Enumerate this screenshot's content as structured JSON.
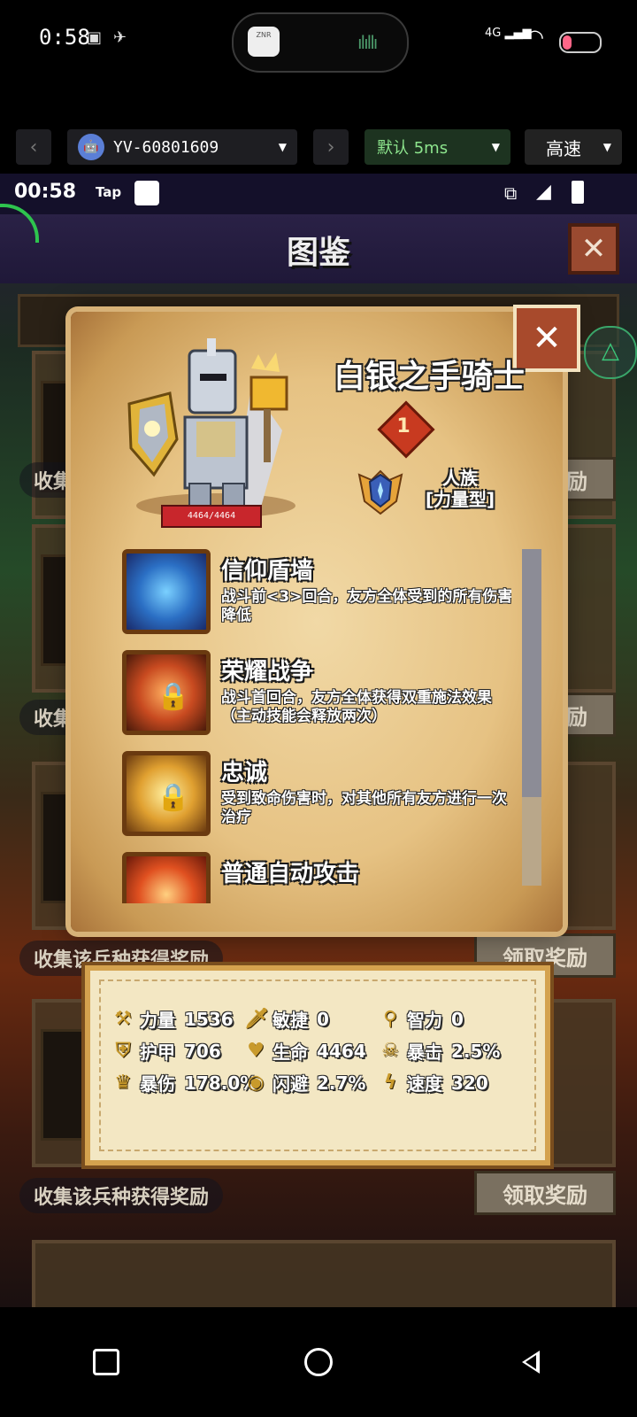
{
  "phone_status": {
    "time": "0:58",
    "signal": "4G",
    "island_app": "ZNR"
  },
  "toolbar": {
    "device": "YV-60801609",
    "mode": "默认 5ms",
    "speed": "高速"
  },
  "game_status": {
    "time": "00:58",
    "tap": "Tap"
  },
  "page": {
    "title": "图鉴"
  },
  "background": {
    "collect_label": "收集该兵种获得奖励",
    "claim_label": "领取奖励"
  },
  "unit": {
    "name": "白银之手骑士",
    "level": "1",
    "race": "人族",
    "type": "[力量型]",
    "hp": "4464/4464"
  },
  "skills": [
    {
      "name": "信仰盾墙",
      "desc": "战斗前<3>回合，友方全体受到的所有伤害降低",
      "locked": false
    },
    {
      "name": "荣耀战争",
      "desc": "战斗首回合，友方全体获得双重施法效果（主动技能会释放两次）",
      "locked": true
    },
    {
      "name": "忠诚",
      "desc": "受到致命伤害时，对其他所有友方进行一次治疗",
      "locked": true
    },
    {
      "name": "普通自动攻击",
      "desc": "",
      "locked": false
    }
  ],
  "stats": [
    {
      "icon": "axe-icon",
      "label": "力量",
      "value": "1536"
    },
    {
      "icon": "sword-icon",
      "label": "敏捷",
      "value": "0"
    },
    {
      "icon": "staff-icon",
      "label": "智力",
      "value": "0"
    },
    {
      "icon": "shield-icon",
      "label": "护甲",
      "value": "706"
    },
    {
      "icon": "heart-icon",
      "label": "生命",
      "value": "4464"
    },
    {
      "icon": "skull-icon",
      "label": "暴击",
      "value": "2.5%"
    },
    {
      "icon": "crown-icon",
      "label": "暴伤",
      "value": "178.0%"
    },
    {
      "icon": "eye-icon",
      "label": "闪避",
      "value": "2.7%"
    },
    {
      "icon": "lightning-icon",
      "label": "速度",
      "value": "320"
    }
  ],
  "colors": {
    "parchment": "#e6c283",
    "accent_red": "#a84a2c",
    "stat_gold": "#c89a2c"
  }
}
